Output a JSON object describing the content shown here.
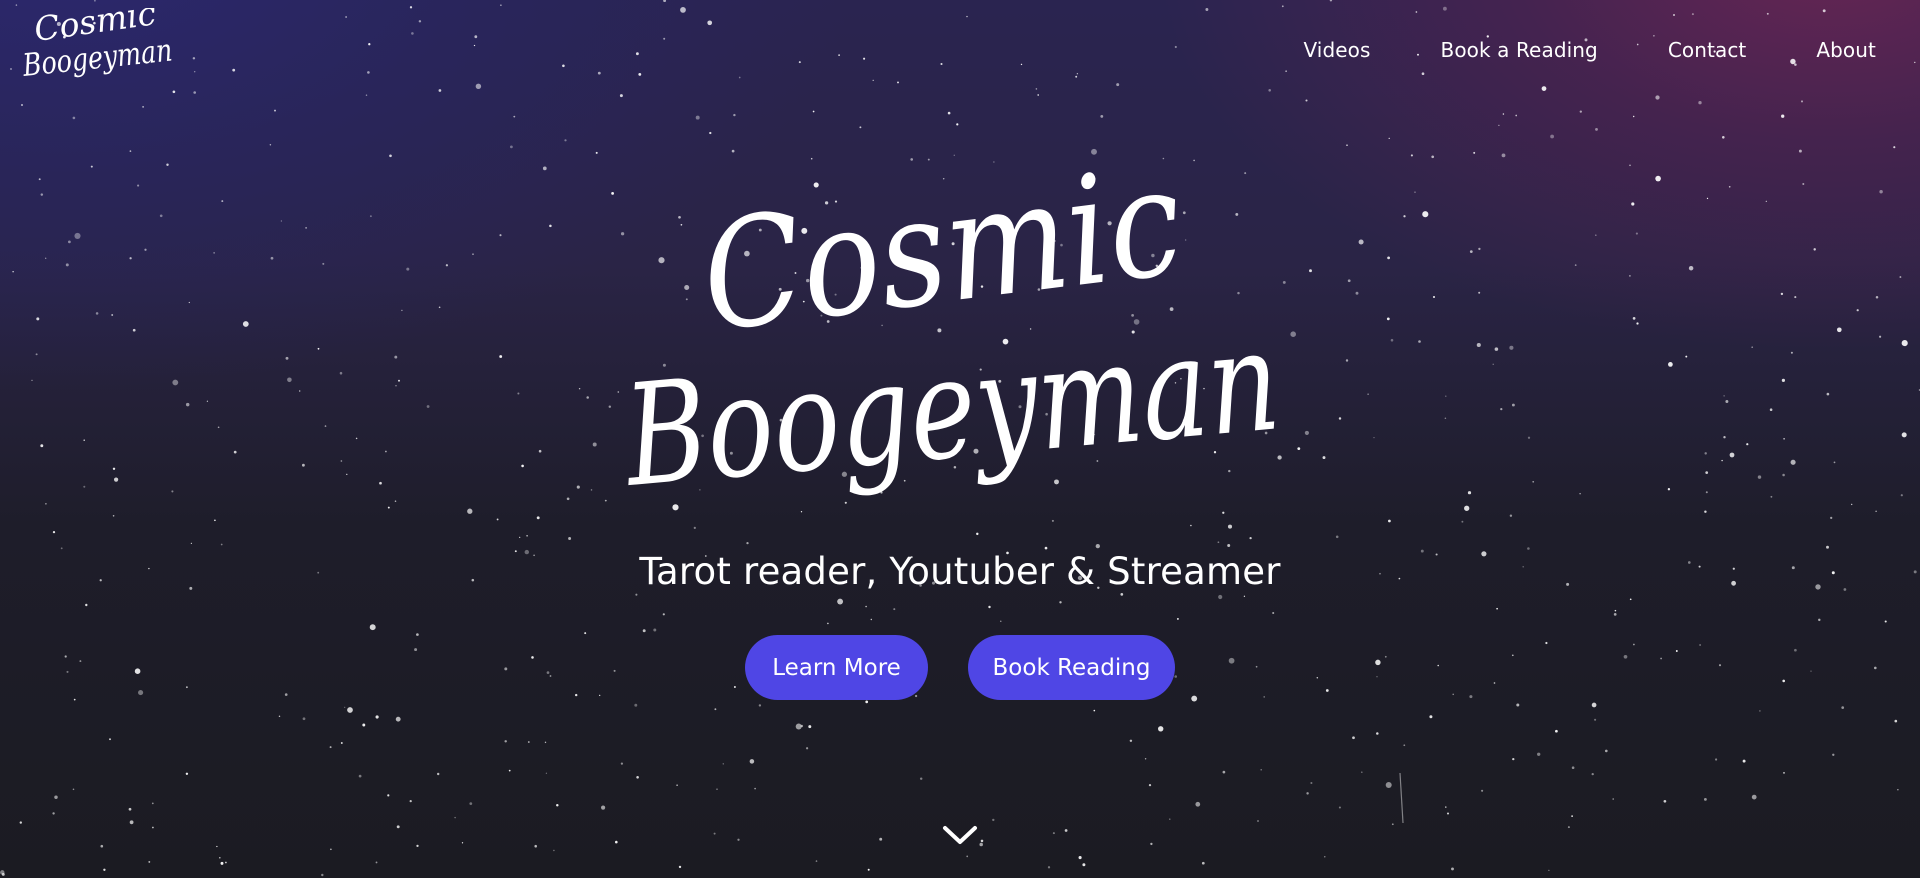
{
  "header": {
    "logo_text": "Cosmic Boogeyman",
    "nav": [
      {
        "label": "Videos"
      },
      {
        "label": "Book a Reading"
      },
      {
        "label": "Contact"
      },
      {
        "label": "About"
      }
    ]
  },
  "hero": {
    "title_line1": "Cosmic",
    "title_line2": "Boogeyman",
    "tagline": "Tarot reader, Youtuber & Streamer",
    "buttons": {
      "learn_more": "Learn More",
      "book_reading": "Book Reading"
    },
    "scroll_icon": "chevron-down-icon"
  },
  "colors": {
    "accent": "#4f46e5",
    "text": "#ffffff",
    "background": "#1c1c24"
  }
}
